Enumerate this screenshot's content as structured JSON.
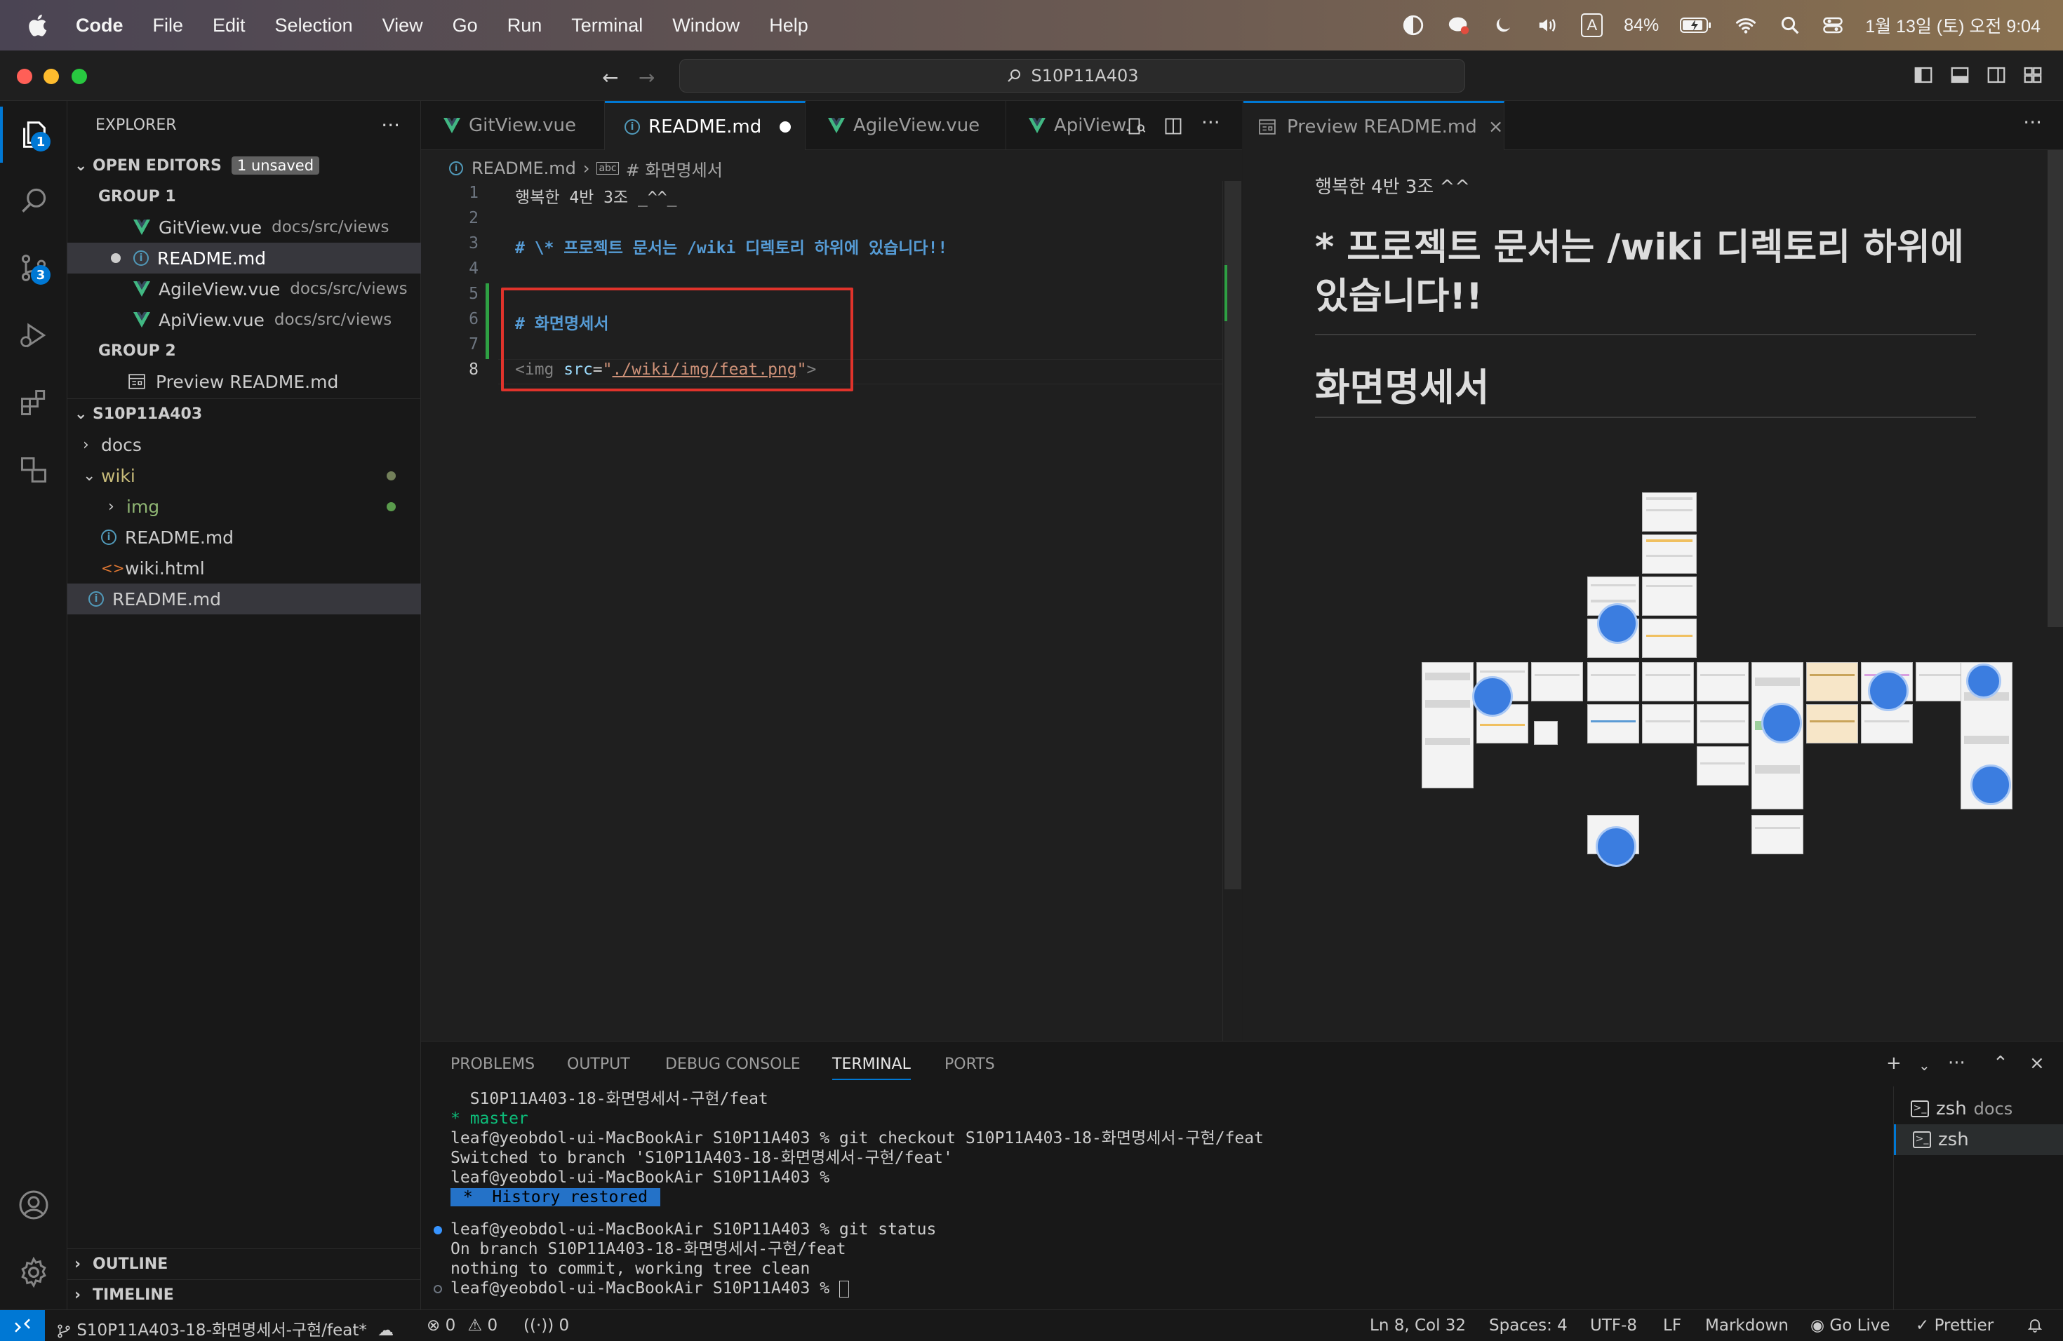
{
  "menubar": {
    "app": "Code",
    "items": [
      "File",
      "Edit",
      "Selection",
      "View",
      "Go",
      "Run",
      "Terminal",
      "Window",
      "Help"
    ],
    "input_method": "A",
    "battery": "84%",
    "datetime": "1월 13일 (토) 오전 9:04"
  },
  "titlebar": {
    "search": "S10P11A403"
  },
  "explorer": {
    "title": "EXPLORER",
    "open_editors": {
      "label": "OPEN EDITORS",
      "badge": "1 unsaved"
    },
    "group1": "GROUP 1",
    "group2": "GROUP 2",
    "group1_items": [
      {
        "name": "GitView.vue",
        "path": "docs/src/views"
      },
      {
        "name": "README.md",
        "path": ""
      },
      {
        "name": "AgileView.vue",
        "path": "docs/src/views"
      },
      {
        "name": "ApiView.vue",
        "path": "docs/src/views"
      }
    ],
    "group2_items": [
      {
        "name": "Preview README.md"
      }
    ],
    "project": "S10P11A403",
    "tree": [
      "docs",
      "wiki",
      "img",
      "README.md",
      "wiki.html",
      "README.md"
    ],
    "outline": "OUTLINE",
    "timeline": "TIMELINE"
  },
  "activity_badges": {
    "explorer": "1",
    "scm": "3"
  },
  "tabs": {
    "left": [
      "GitView.vue",
      "README.md",
      "AgileView.vue",
      "ApiView."
    ],
    "right": "Preview README.md"
  },
  "editor": {
    "breadcrumb": {
      "file": "README.md",
      "symbol": "# 화면명세서"
    },
    "lines": [
      {
        "n": "1",
        "text": "행복한 4반 3조 _^^_"
      },
      {
        "n": "2",
        "text": ""
      },
      {
        "n": "3",
        "text": "# \\* 프로젝트 문서는 /wiki 디렉토리 하위에 있습니다!!"
      },
      {
        "n": "4",
        "text": ""
      },
      {
        "n": "5",
        "text": ""
      },
      {
        "n": "6",
        "text": "# 화면명세서"
      },
      {
        "n": "7",
        "text": ""
      },
      {
        "n": "8",
        "text": ""
      }
    ],
    "img_line": {
      "open": "<img",
      "attr": "src",
      "eq": "=",
      "q1": "\"",
      "value": "./wiki/img/feat.png",
      "q2": "\"",
      "close": ">"
    }
  },
  "preview": {
    "paragraph": "행복한 4반 3조 ^^",
    "h1": "* 프로젝트 문서는 /wiki 디렉토리 하위에 있습니다!!",
    "h2": "화면명세서"
  },
  "panel": {
    "tabs": [
      "PROBLEMS",
      "OUTPUT",
      "DEBUG CONSOLE",
      "TERMINAL",
      "PORTS"
    ],
    "active_tab": "TERMINAL",
    "terminal": [
      "  S10P11A403-18-화면명세서-구현/feat",
      "* master",
      "leaf@yeobdol-ui-MacBookAir S10P11A403 % git checkout S10P11A403-18-화면명세서-구현/feat",
      "Switched to branch 'S10P11A403-18-화면명세서-구현/feat'",
      "leaf@yeobdol-ui-MacBookAir S10P11A403 %",
      " *  History restored ",
      "leaf@yeobdol-ui-MacBookAir S10P11A403 % git status",
      "On branch S10P11A403-18-화면명세서-구현/feat",
      "nothing to commit, working tree clean",
      "leaf@yeobdol-ui-MacBookAir S10P11A403 % "
    ],
    "terminals": [
      {
        "name": "zsh",
        "cwd": "docs"
      },
      {
        "name": "zsh",
        "cwd": ""
      }
    ]
  },
  "statusbar": {
    "branch": "S10P11A403-18-화면명세서-구현/feat*",
    "errors": "0",
    "warnings": "0",
    "ports": "0",
    "position": "Ln 8, Col 32",
    "spaces": "Spaces: 4",
    "encoding": "UTF-8",
    "eol": "LF",
    "language": "Markdown",
    "golive": "Go Live",
    "prettier": "Prettier"
  },
  "colors": {
    "accent": "#0078d4",
    "highlight_box": "#e0332b",
    "vue_green": "#41b883",
    "heading": "#569cd6",
    "string": "#ce9178"
  },
  "icons": [
    "apple-icon",
    "files-icon",
    "search-icon",
    "source-control-icon",
    "run-debug-icon",
    "extensions-icon",
    "remote-explorer-icon",
    "account-icon",
    "settings-gear-icon"
  ]
}
